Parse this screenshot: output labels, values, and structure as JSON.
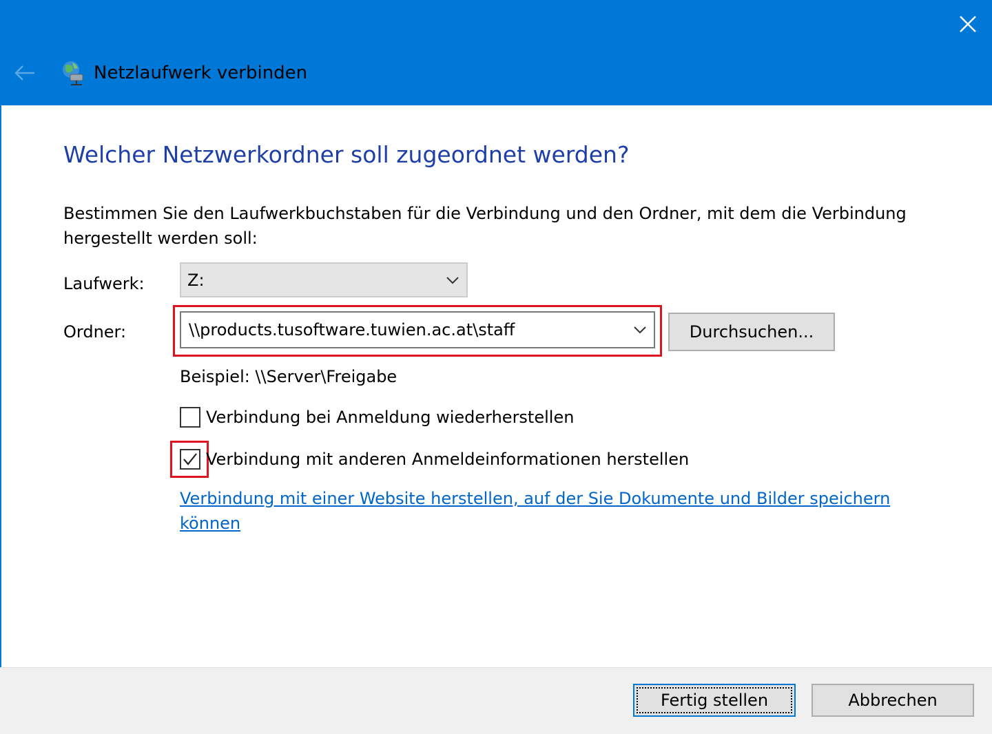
{
  "window": {
    "title": "Netzlaufwerk verbinden",
    "back_icon": "back-arrow-icon",
    "app_icon": "network-drive-icon",
    "close_icon": "close-icon",
    "titlebar_color": "#0078d7"
  },
  "main": {
    "heading": "Welcher Netzwerkordner soll zugeordnet werden?",
    "description": "Bestimmen Sie den Laufwerkbuchstaben für die Verbindung und den Ordner, mit dem die Verbindung hergestellt werden soll:",
    "drive": {
      "label": "Laufwerk:",
      "value": "Z:"
    },
    "folder": {
      "label": "Ordner:",
      "value": "\\\\products.tusoftware.tuwien.ac.at\\staff",
      "highlighted": true
    },
    "browse_button": "Durchsuchen...",
    "example": "Beispiel: \\\\Server\\Freigabe",
    "reconnect_checkbox": {
      "label": "Verbindung bei Anmeldung wiederherstellen",
      "checked": false
    },
    "credentials_checkbox": {
      "label": "Verbindung mit anderen Anmeldeinformationen herstellen",
      "checked": true,
      "highlighted": true
    },
    "website_link": "Verbindung mit einer Website herstellen, auf der Sie Dokumente und Bilder speichern können"
  },
  "footer": {
    "finish_button": "Fertig stellen",
    "cancel_button": "Abbrechen"
  },
  "colors": {
    "heading": "#1e3ea8",
    "link": "#0066cc",
    "highlight": "#e0141e"
  }
}
